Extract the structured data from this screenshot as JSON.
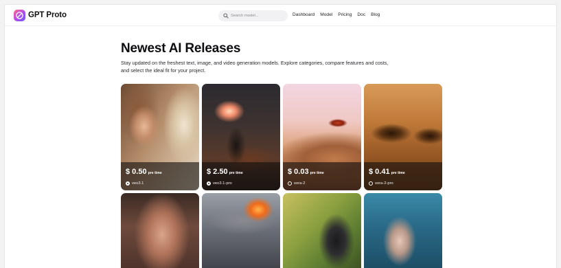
{
  "header": {
    "brand": "GPT Proto",
    "search_placeholder": "Search model...",
    "nav": [
      "Dashboard",
      "Model",
      "Pricing",
      "Doc",
      "Blog"
    ]
  },
  "hero": {
    "title": "Newest AI Releases",
    "description": "Stay updated on the freshest text, image, and video generation models. Explore categories, compare features and costs, and select the ideal fit for your project."
  },
  "cards": [
    {
      "price": "$ 0.50",
      "unit": "pre time",
      "model": "veo3.1",
      "icon": "gemini-dot-icon"
    },
    {
      "price": "$ 2.50",
      "unit": "pre time",
      "model": "veo3.1-pro",
      "icon": "gemini-dot-icon"
    },
    {
      "price": "$ 0.03",
      "unit": "pre time",
      "model": "sora-2",
      "icon": "openai-icon"
    },
    {
      "price": "$ 0.41",
      "unit": "pre time",
      "model": "sora-2-pro",
      "icon": "openai-icon"
    }
  ],
  "colors": {
    "accent_gradient_start": "#ff6a8b",
    "accent_gradient_end": "#6b5cf6",
    "text": "#111111",
    "overlay": "rgba(20,16,14,0.62)"
  }
}
